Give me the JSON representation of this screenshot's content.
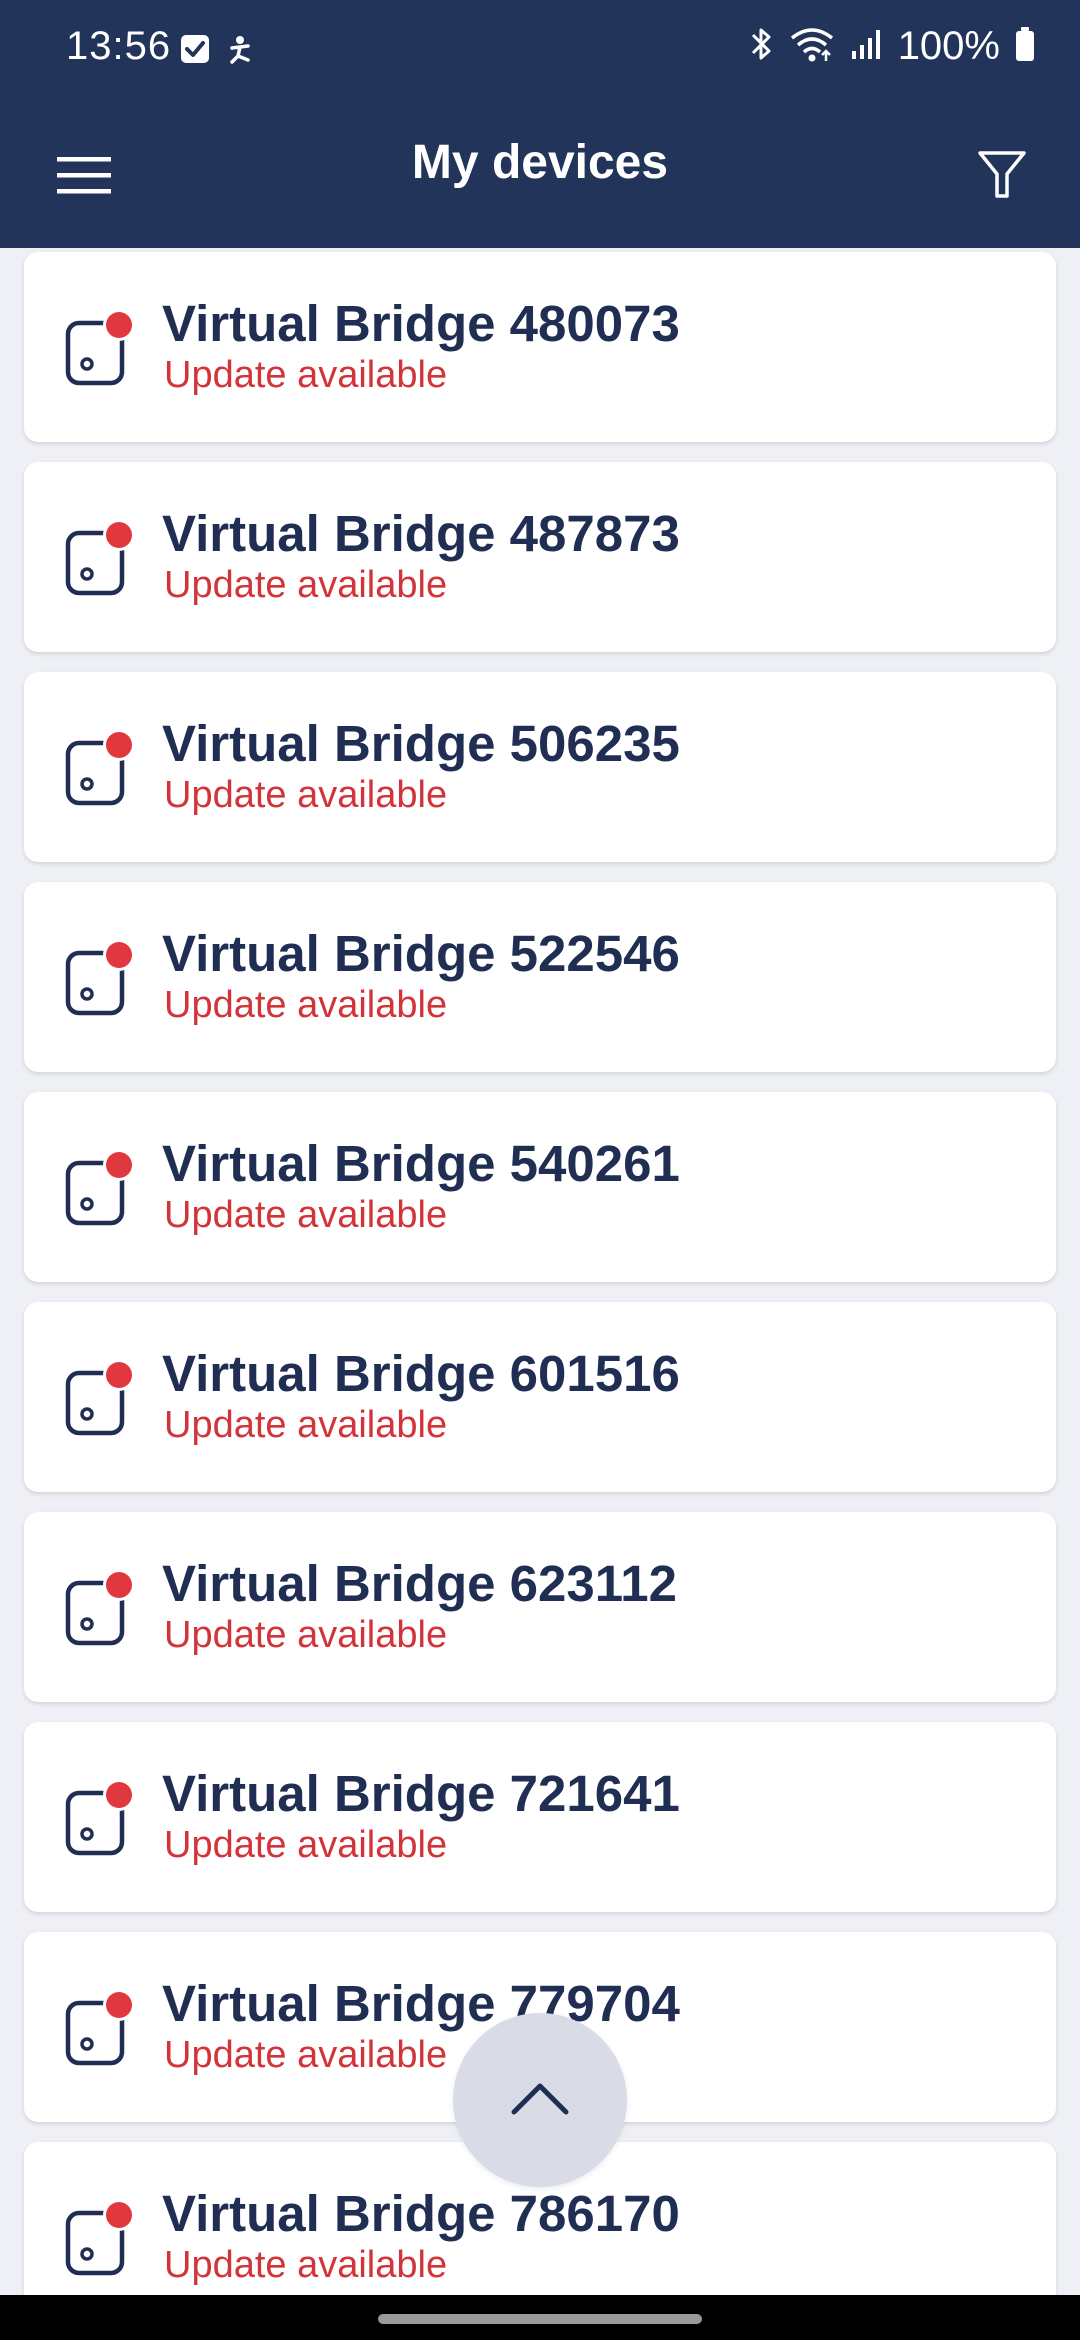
{
  "status_bar": {
    "time": "13:56",
    "battery": "100%",
    "icons": [
      "checkbox-notification-icon",
      "accessibility-icon",
      "bluetooth-icon",
      "wifi-icon",
      "signal-icon",
      "battery-icon"
    ]
  },
  "app_bar": {
    "title": "My devices",
    "menu_icon": "hamburger-menu-icon",
    "filter_icon": "filter-icon"
  },
  "devices": [
    {
      "name": "Virtual Bridge 480073",
      "status": "Update available"
    },
    {
      "name": "Virtual Bridge 487873",
      "status": "Update available"
    },
    {
      "name": "Virtual Bridge 506235",
      "status": "Update available"
    },
    {
      "name": "Virtual Bridge 522546",
      "status": "Update available"
    },
    {
      "name": "Virtual Bridge 540261",
      "status": "Update available"
    },
    {
      "name": "Virtual Bridge 601516",
      "status": "Update available"
    },
    {
      "name": "Virtual Bridge 623112",
      "status": "Update available"
    },
    {
      "name": "Virtual Bridge 721641",
      "status": "Update available"
    },
    {
      "name": "Virtual Bridge 779704",
      "status": "Update available"
    },
    {
      "name": "Virtual Bridge 786170",
      "status": "Update available"
    }
  ],
  "scroll_top_icon": "chevron-up-icon",
  "colors": {
    "header": "#22345A",
    "background": "#EEF0F5",
    "device_name": "#1F2E52",
    "update_status": "#D2343A",
    "badge": "#E0383E"
  }
}
